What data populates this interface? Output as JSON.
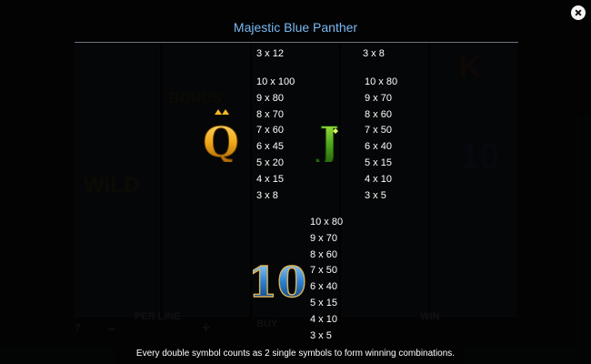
{
  "title": "Majestic Blue Panther",
  "columns": {
    "left_top": [
      "3 x 12"
    ],
    "right_top": [
      "3 x 8"
    ],
    "q_payouts": [
      "10 x 100",
      "9 x 80",
      "8 x 70",
      "7 x 60",
      "6 x 45",
      "5 x 20",
      "4 x 15",
      "3 x 8"
    ],
    "j_payouts": [
      "10 x 80",
      "9 x 70",
      "8 x 60",
      "7 x 50",
      "6 x 40",
      "5 x 15",
      "4 x 10",
      "3 x 5"
    ],
    "ten_payouts": [
      "10 x 80",
      "9 x 70",
      "8 x 60",
      "7 x 50",
      "6 x 40",
      "5 x 15",
      "4 x 10",
      "3 x 5"
    ]
  },
  "symbols": {
    "q": "Q",
    "j": "J",
    "ten": "10"
  },
  "footer": "Every double symbol counts as 2 single symbols to form winning combinations."
}
